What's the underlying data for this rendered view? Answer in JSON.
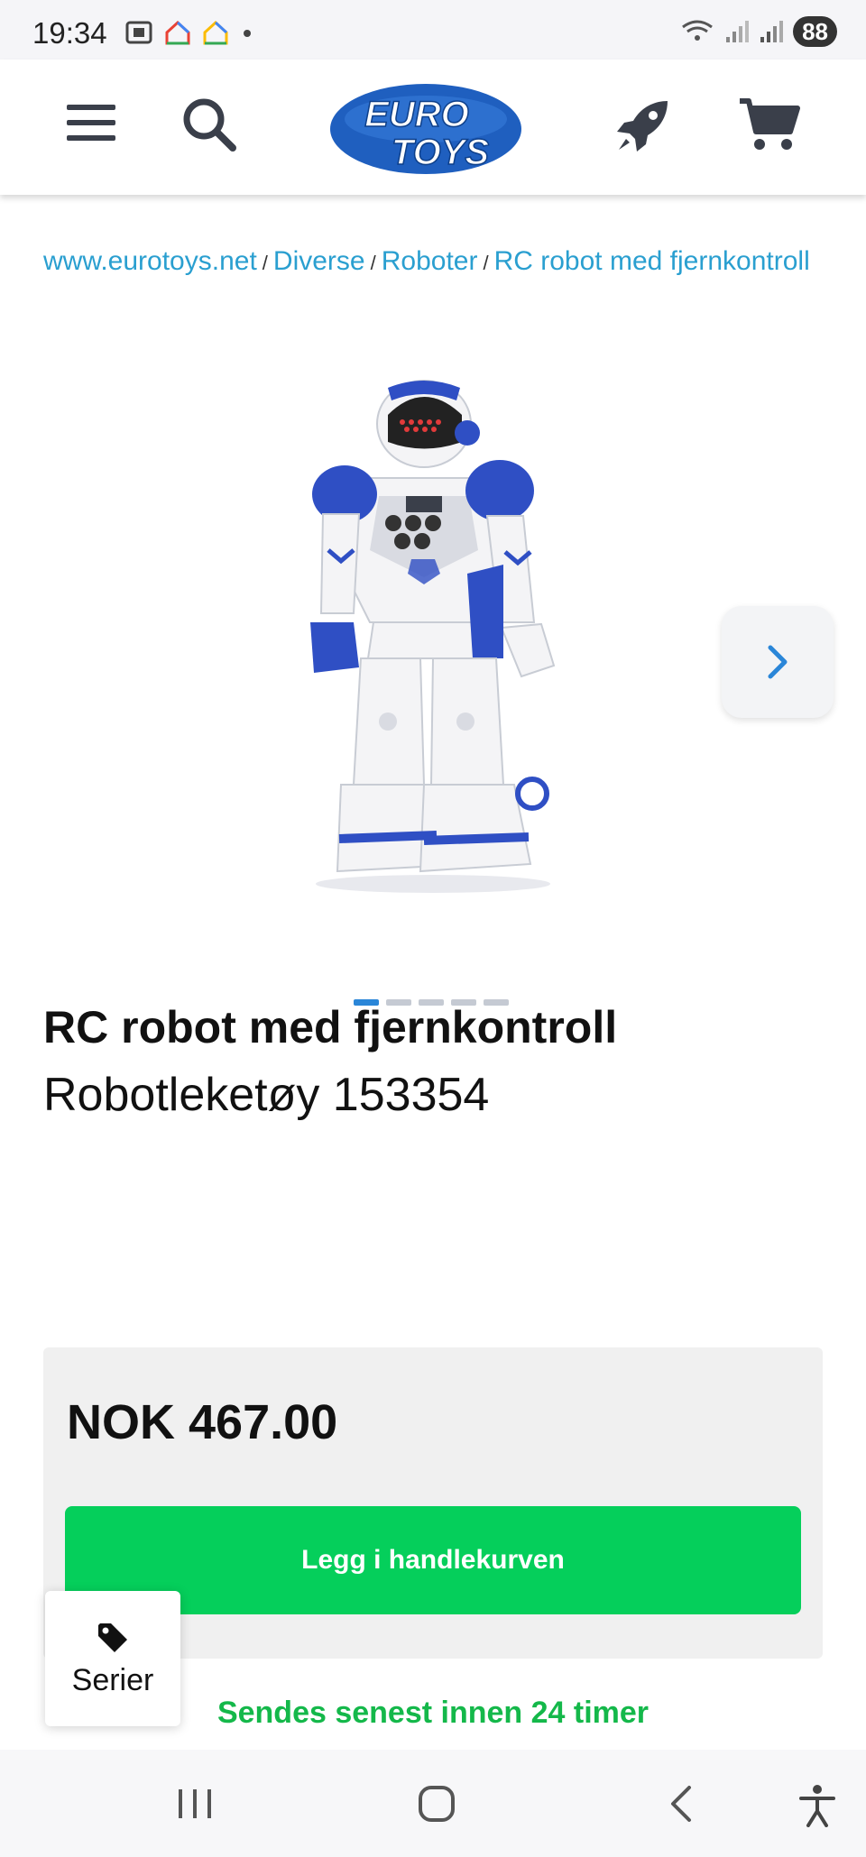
{
  "status_bar": {
    "time": "19:34",
    "battery": "88"
  },
  "header": {
    "logo_text_1": "EURO",
    "logo_text_2": "TOYS",
    "brand_color": "#1f5fbf"
  },
  "breadcrumb": {
    "items": [
      "www.eurotoys.net",
      "Diverse",
      "Roboter",
      "RC robot med fjernkontroll"
    ],
    "separator": "/"
  },
  "gallery": {
    "dots": 5,
    "active_index": 0
  },
  "product": {
    "title": "RC robot med fjernkontroll",
    "subtitle": "Robotleketøy 153354"
  },
  "purchase": {
    "price": "NOK 467.00",
    "cart_button_label": "Legg i handlekurven",
    "shipping_note": "Sendes senest innen 24 timer",
    "accent_color": "#05cf5b"
  },
  "series_button": {
    "label": "Serier"
  }
}
